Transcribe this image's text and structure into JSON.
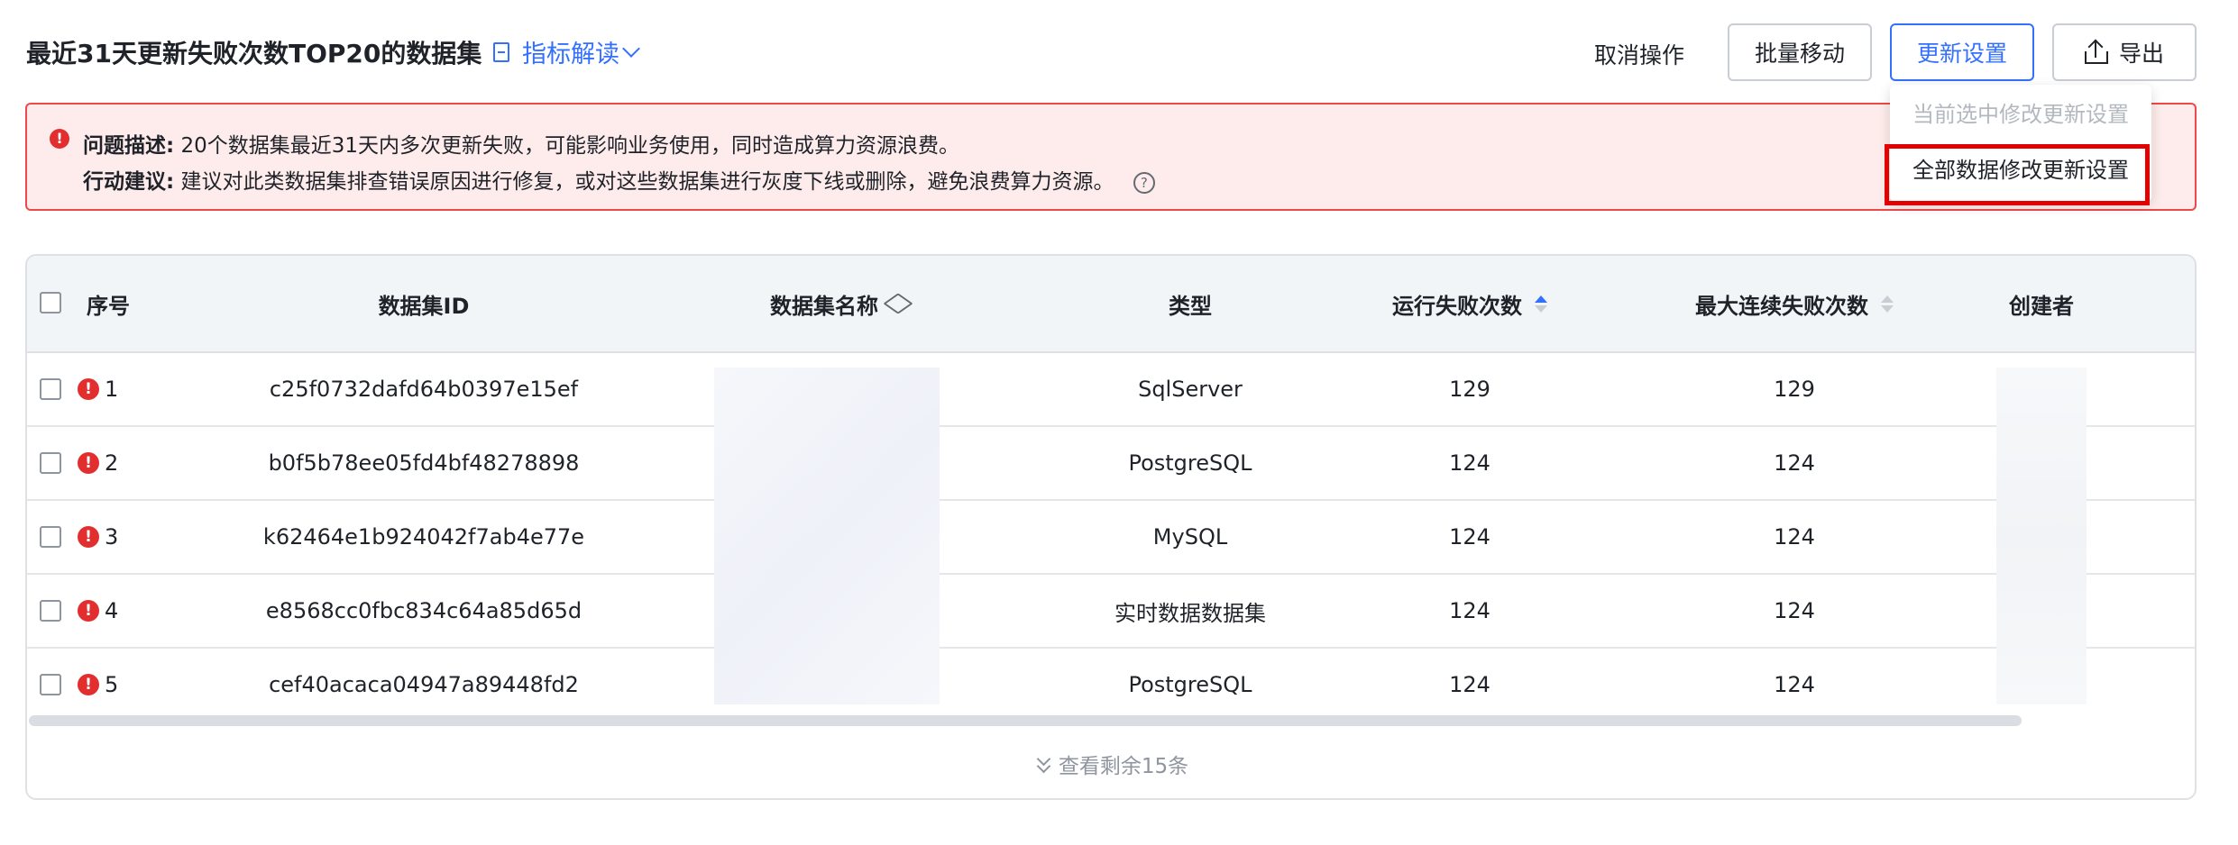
{
  "header": {
    "title": "最近31天更新失败次数TOP20的数据集",
    "indicator_label": "指标解读",
    "cancel_label": "取消操作",
    "batch_move_label": "批量移动",
    "update_settings_label": "更新设置",
    "export_label": "导出"
  },
  "dropdown": {
    "items": [
      "当前选中修改更新设置",
      "全部数据修改更新设置"
    ]
  },
  "alert": {
    "problem_label": "问题描述:",
    "problem_text": "20个数据集最近31天内多次更新失败，可能影响业务使用，同时造成算力资源浪费。",
    "action_label": "行动建议:",
    "action_text": "建议对此类数据集排查错误原因进行修复，或对这些数据集进行灰度下线或删除，避免浪费算力资源。"
  },
  "table": {
    "columns": [
      "序号",
      "数据集ID",
      "数据集名称",
      "类型",
      "运行失败次数",
      "最大连续失败次数",
      "创建者"
    ],
    "rows": [
      {
        "index": "1",
        "id": "c25f0732dafd64b0397e15ef",
        "type": "SqlServer",
        "fail_count": "129",
        "max_consecutive": "129"
      },
      {
        "index": "2",
        "id": "b0f5b78ee05fd4bf48278898",
        "type": "PostgreSQL",
        "fail_count": "124",
        "max_consecutive": "124"
      },
      {
        "index": "3",
        "id": "k62464e1b924042f7ab4e77e",
        "type": "MySQL",
        "fail_count": "124",
        "max_consecutive": "124"
      },
      {
        "index": "4",
        "id": "e8568cc0fbc834c64a85d65d",
        "type": "实时数据数据集",
        "fail_count": "124",
        "max_consecutive": "124"
      },
      {
        "index": "5",
        "id": "cef40acaca04947a89448fd2",
        "type": "PostgreSQL",
        "fail_count": "124",
        "max_consecutive": "124"
      }
    ],
    "show_more_label": "查看剩余15条"
  },
  "colors": {
    "accent": "#3370ff",
    "error": "#e22e2e",
    "alert_bg": "#fdeceb",
    "highlight": "#e30000"
  },
  "icons": [
    "book-icon",
    "chevron-down-icon",
    "export-icon",
    "error-icon",
    "help-icon",
    "send-icon",
    "sort-icon",
    "double-chevron-down-icon"
  ]
}
